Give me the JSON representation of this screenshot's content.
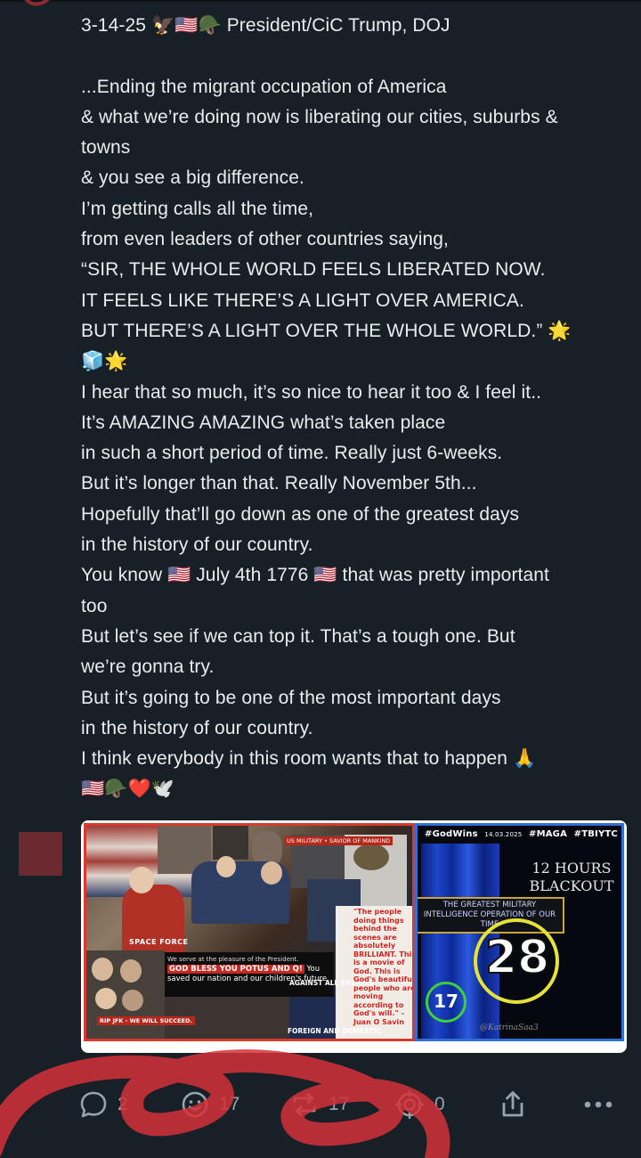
{
  "post": {
    "lines": [
      "3-14-25 🦅🇺🇸🪖 President/CiC Trump, DOJ",
      "",
      "...Ending the migrant occupation of America",
      "& what we’re doing now is liberating our cities, suburbs &",
      "towns",
      "& you see a big difference.",
      "I’m getting calls all the time,",
      "from even leaders of other countries saying,",
      "“SIR, THE WHOLE WORLD FEELS LIBERATED NOW.",
      "IT FEELS LIKE THERE’S A LIGHT OVER AMERICA.",
      "BUT THERE’S A LIGHT OVER THE WHOLE WORLD.” 🌟",
      "🧊🌟",
      "I hear that so much, it’s so nice to hear it too & I feel it..",
      "It’s AMAZING AMAZING what’s taken place",
      "in such a short period of time. Really just 6-weeks.",
      "But it’s longer than that. Really November 5th...",
      "Hopefully that’ll go down as one of the greatest days",
      "in the history of our country.",
      "You know 🇺🇸 July 4th 1776 🇺🇸 that was pretty important",
      "too",
      "But let’s see if we can top it. That’s a tough one. But",
      "we’re gonna try.",
      "But it’s going to be one of the most important days",
      "in the history of our country.",
      "I think everybody in this room wants that to happen 🙏",
      "🇺🇸🪖❤️🕊️"
    ]
  },
  "media": {
    "left_image": {
      "us_military_tag": "US MILITARY • SAVIOR OF MANKIND",
      "space_force": "SPACE FORCE",
      "serve_line": "We serve at the pleasure of the President.",
      "god_bless": "GOD BLESS YOU POTUS AND Q!",
      "saved_line": "You saved our nation and our children's future.",
      "against": "AGAINST ALL ENEMIES",
      "foreign": "FOREIGN AND DOMESTIC",
      "rip": "RIP JFK - WE WILL SUCCEED.",
      "people_quote": "\"The people doing things behind the scenes are absolutely BRILLIANT. This is a movie of God. This is God's beautiful people who are moving according to God's will.\" – Juan O Savin"
    },
    "right_image": {
      "tag_godwins": "#GodWins",
      "date": "14.03.2025",
      "tag_maga": "#MAGA",
      "tag_tbiytc": "#TBIYTC",
      "blackout": "12 HOURS BLACKOUT",
      "greatest": "THE GREATEST MILITARY INTELLIGENCE OPERATION OF OUR TIME",
      "big_number": "28",
      "small_number": "17",
      "signature": "@KatrinaSaa3"
    }
  },
  "actions": {
    "replies": "2",
    "reactions": "17",
    "reposts": "17",
    "bookmarks": "0",
    "colors": {
      "icon": "#98a3ab",
      "background": "#172026",
      "scribble": "#d4313a"
    }
  }
}
